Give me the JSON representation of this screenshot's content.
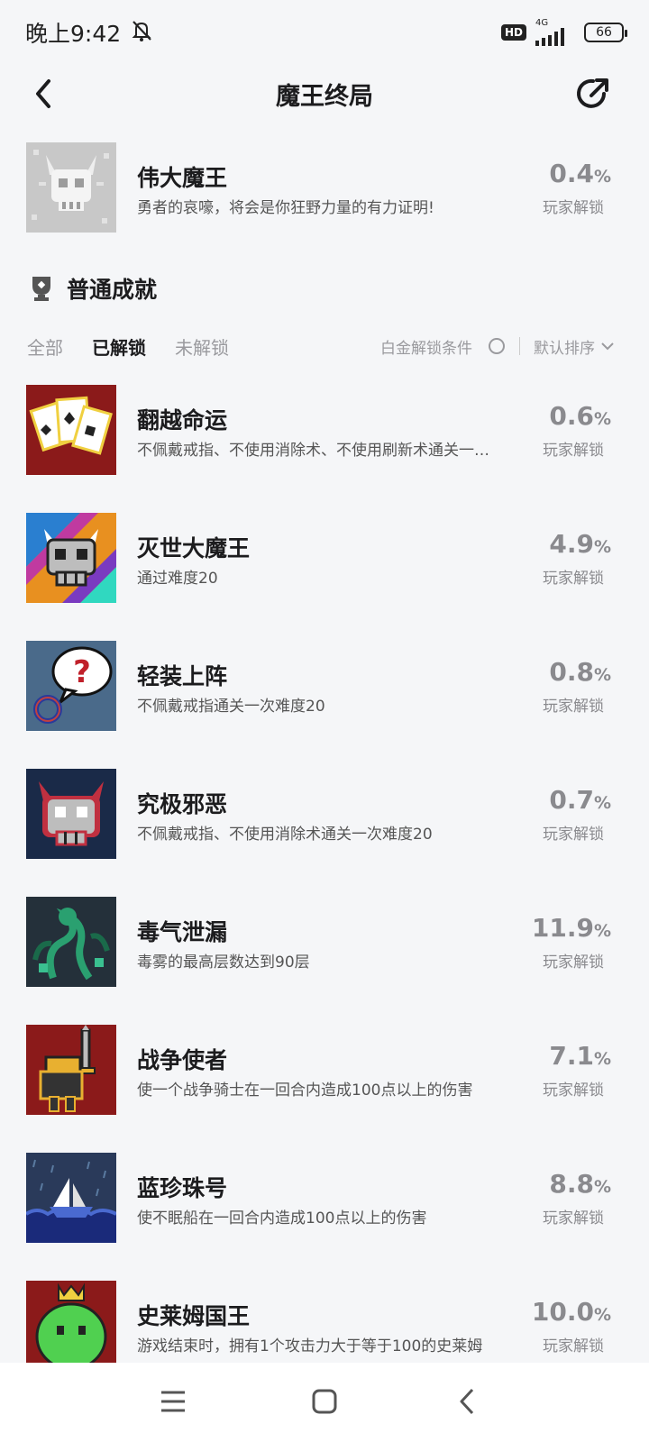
{
  "status_bar": {
    "time": "晚上9:42",
    "hd": "HD",
    "network": "4G",
    "battery": "66"
  },
  "header": {
    "title": "魔王终局"
  },
  "featured": {
    "name": "伟大魔王",
    "desc": "勇者的哀嚎，将会是你狂野力量的有力证明!",
    "pct": "0.4",
    "unit": "%",
    "unlock_label": "玩家解锁"
  },
  "section": {
    "title": "普通成就"
  },
  "filters": {
    "tabs": [
      "全部",
      "已解锁",
      "未解锁"
    ],
    "active_tab": "已解锁",
    "condition_label": "白金解锁条件",
    "sort_label": "默认排序"
  },
  "achievements": [
    {
      "name": "翻越命运",
      "desc": "不佩戴戒指、不使用消除术、不使用刷新术通关一…",
      "pct": "0.6",
      "unit": "%",
      "unlock_label": "玩家解锁",
      "icon": "cards-icon"
    },
    {
      "name": "灭世大魔王",
      "desc": "通过难度20",
      "pct": "4.9",
      "unit": "%",
      "unlock_label": "玩家解锁",
      "icon": "rainbow-skull-icon"
    },
    {
      "name": "轻装上阵",
      "desc": "不佩戴戒指通关一次难度20",
      "pct": "0.8",
      "unit": "%",
      "unlock_label": "玩家解锁",
      "icon": "question-ring-icon"
    },
    {
      "name": "究极邪恶",
      "desc": "不佩戴戒指、不使用消除术通关一次难度20",
      "pct": "0.7",
      "unit": "%",
      "unlock_label": "玩家解锁",
      "icon": "evil-skull-icon"
    },
    {
      "name": "毒气泄漏",
      "desc": "毒雾的最高层数达到90层",
      "pct": "11.9",
      "unit": "%",
      "unlock_label": "玩家解锁",
      "icon": "poison-gas-icon"
    },
    {
      "name": "战争使者",
      "desc": "使一个战争骑士在一回合内造成100点以上的伤害",
      "pct": "7.1",
      "unit": "%",
      "unlock_label": "玩家解锁",
      "icon": "war-knight-icon"
    },
    {
      "name": "蓝珍珠号",
      "desc": "使不眠船在一回合内造成100点以上的伤害",
      "pct": "8.8",
      "unit": "%",
      "unlock_label": "玩家解锁",
      "icon": "ship-icon"
    },
    {
      "name": "史莱姆国王",
      "desc": "游戏结束时，拥有1个攻击力大于等于100的史莱姆",
      "pct": "10.0",
      "unit": "%",
      "unlock_label": "玩家解锁",
      "icon": "slime-king-icon"
    }
  ],
  "colors": {
    "background": "#f5f6f8",
    "text_primary": "#1c1c1e",
    "text_secondary": "#8a8a8e"
  }
}
